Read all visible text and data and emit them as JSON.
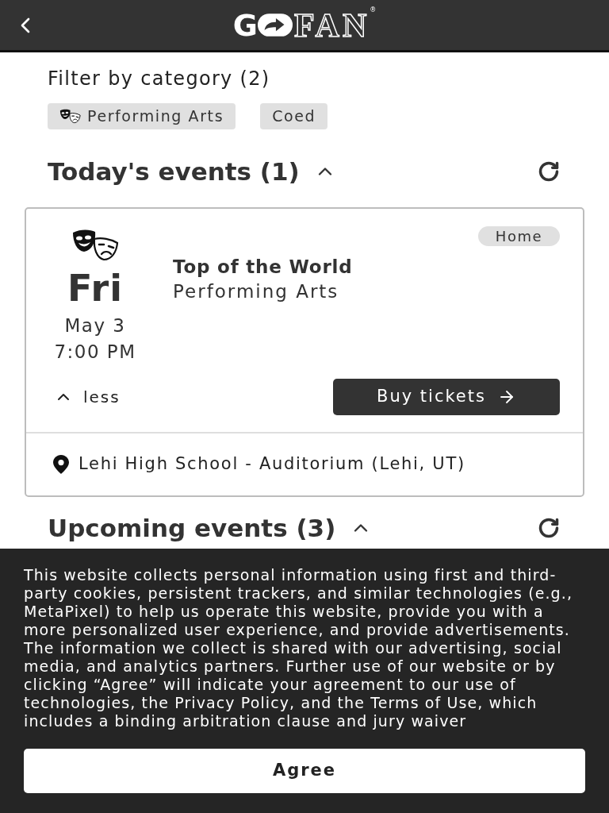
{
  "header": {
    "logo": {
      "lead": "G",
      "tail": "FAN",
      "mark": "®"
    }
  },
  "filter": {
    "title": "Filter by category (2)",
    "chips": [
      {
        "label": "Performing Arts",
        "kind": "icon"
      },
      {
        "label": "Coed",
        "kind": "text"
      }
    ]
  },
  "sections": [
    {
      "title": "Today's events (1)",
      "expanded": true,
      "events": [
        {
          "day": "Fri",
          "date": "May 3",
          "time": "7:00 PM",
          "title": "Top of the World",
          "category": "Performing Arts",
          "badge": "Home",
          "expanded": true,
          "toggle": "less",
          "action": "Buy tickets",
          "venue": "Lehi High School - Auditorium (Lehi, UT)"
        }
      ]
    },
    {
      "title": "Upcoming events (3)",
      "expanded": true
    }
  ],
  "cookie_banner": {
    "text": "This website collects personal information using first and third-party cookies, persistent trackers, and similar technologies (e.g., MetaPixel) to help us operate this website, provide you with a more personalized user experience, and provide advertisements. The information we collect is shared with our advertising, social media, and analytics partners. Further use of our website or by clicking “Agree” will indicate your agreement to our use of technologies, the Privacy Policy, and the Terms of Use, which includes a binding arbitration clause and jury waiver",
    "button": "Agree"
  }
}
